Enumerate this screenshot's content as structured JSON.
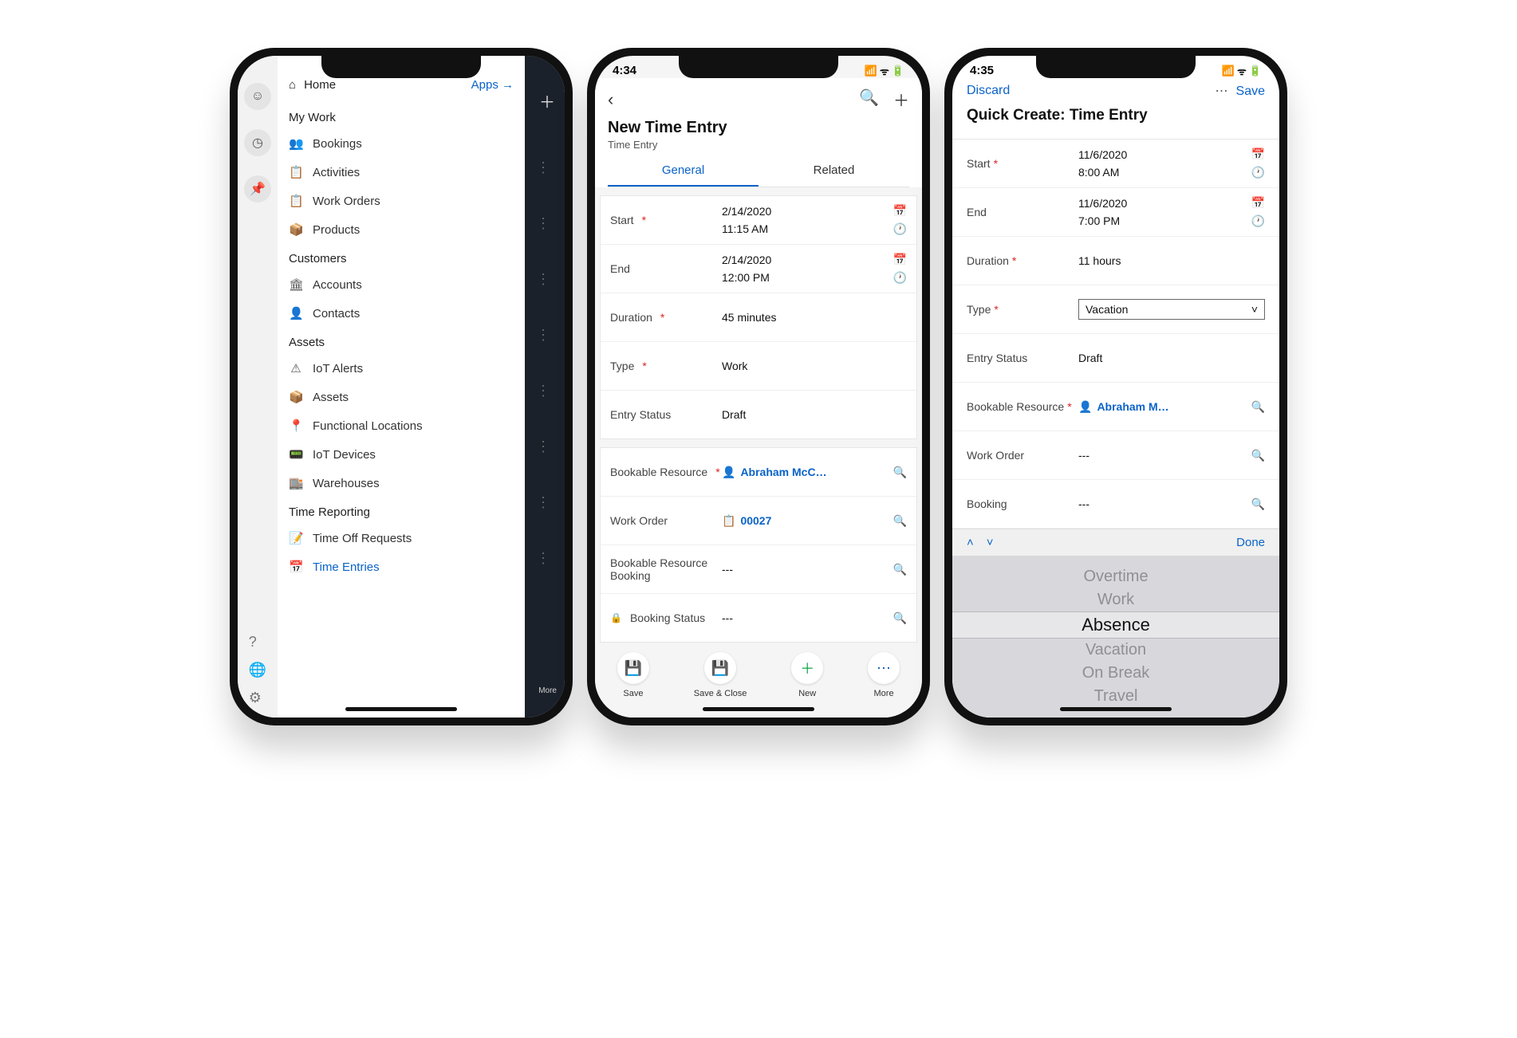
{
  "phone1": {
    "home_label": "Home",
    "apps_label": "Apps →",
    "sections": {
      "my_work": "My Work",
      "customers": "Customers",
      "assets": "Assets",
      "time_reporting": "Time Reporting"
    },
    "items": {
      "bookings": "Bookings",
      "activities": "Activities",
      "work_orders": "Work Orders",
      "products": "Products",
      "accounts": "Accounts",
      "contacts": "Contacts",
      "iot_alerts": "IoT Alerts",
      "assets": "Assets",
      "functional_locations": "Functional Locations",
      "iot_devices": "IoT Devices",
      "warehouses": "Warehouses",
      "time_off_requests": "Time Off Requests",
      "time_entries": "Time Entries"
    },
    "more_label": "More"
  },
  "phone2": {
    "clock": "4:34",
    "title": "New Time Entry",
    "subtitle": "Time Entry",
    "tabs": {
      "general": "General",
      "related": "Related"
    },
    "fields": {
      "start_label": "Start",
      "start_date": "2/14/2020",
      "start_time": "11:15 AM",
      "end_label": "End",
      "end_date": "2/14/2020",
      "end_time": "12:00 PM",
      "duration_label": "Duration",
      "duration_value": "45 minutes",
      "type_label": "Type",
      "type_value": "Work",
      "entry_status_label": "Entry Status",
      "entry_status_value": "Draft",
      "bookable_resource_label": "Bookable Resource",
      "bookable_resource_value": "Abraham McC…",
      "work_order_label": "Work Order",
      "work_order_value": "00027",
      "brb_label": "Bookable Resource Booking",
      "brb_value": "---",
      "booking_status_label": "Booking Status",
      "booking_status_value": "---"
    },
    "buttons": {
      "save": "Save",
      "save_close": "Save & Close",
      "new": "New",
      "more": "More"
    }
  },
  "phone3": {
    "clock": "4:35",
    "discard": "Discard",
    "save": "Save",
    "title": "Quick Create: Time Entry",
    "fields": {
      "start_label": "Start",
      "start_date": "11/6/2020",
      "start_time": "8:00 AM",
      "end_label": "End",
      "end_date": "11/6/2020",
      "end_time": "7:00 PM",
      "duration_label": "Duration",
      "duration_value": "11 hours",
      "type_label": "Type",
      "type_value": "Vacation",
      "entry_status_label": "Entry Status",
      "entry_status_value": "Draft",
      "bookable_resource_label": "Bookable Resource",
      "bookable_resource_value": "Abraham M…",
      "work_order_label": "Work Order",
      "work_order_value": "---",
      "booking_label": "Booking",
      "booking_value": "---"
    },
    "done": "Done",
    "picker": [
      "Overtime",
      "Work",
      "Absence",
      "Vacation",
      "On Break",
      "Travel"
    ],
    "picker_selected_index": 2
  }
}
